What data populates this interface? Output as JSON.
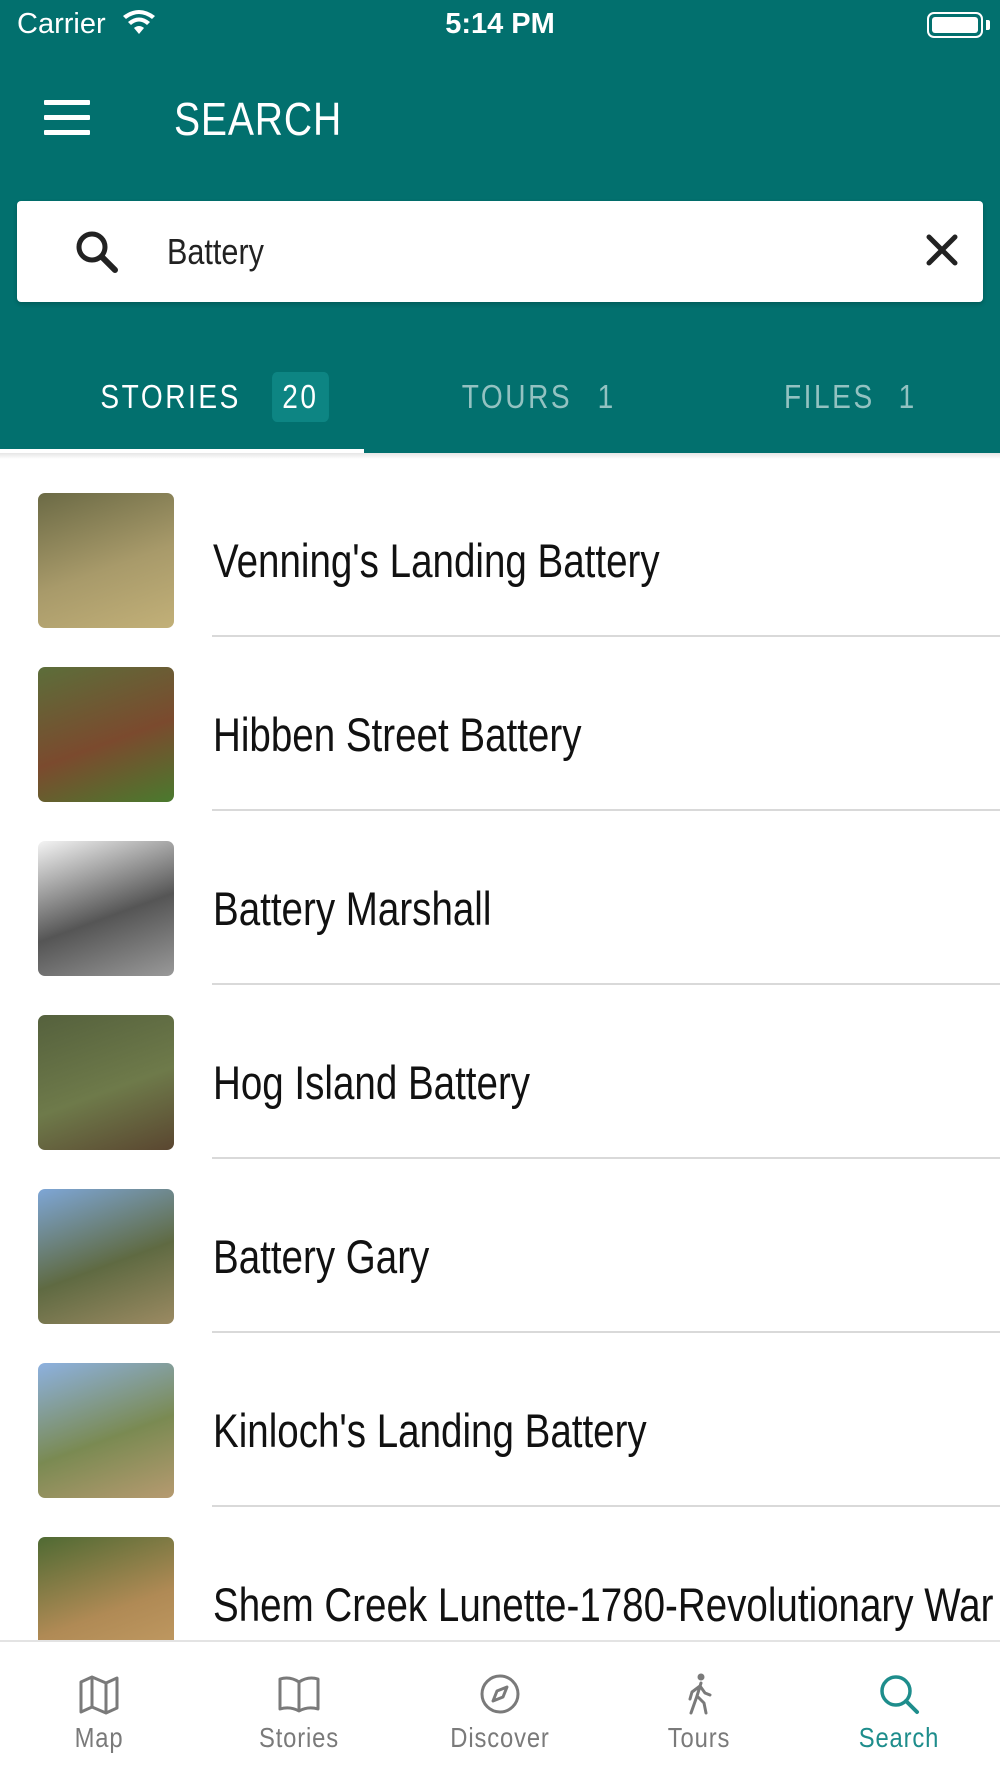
{
  "status_bar": {
    "carrier": "Carrier",
    "time": "5:14 PM"
  },
  "header": {
    "title": "SEARCH"
  },
  "search": {
    "value": "Battery",
    "placeholder": ""
  },
  "tabs": [
    {
      "label": "STORIES",
      "count": "20",
      "active": true
    },
    {
      "label": "TOURS",
      "count": "1",
      "active": false
    },
    {
      "label": "FILES",
      "count": "1",
      "active": false
    }
  ],
  "results": [
    {
      "title": "Venning's Landing Battery",
      "thumb_colors": [
        "#6b6a45",
        "#a89a6a",
        "#c2b078"
      ]
    },
    {
      "title": "Hibben Street Battery",
      "thumb_colors": [
        "#5c6e3a",
        "#7b4a2e",
        "#4a7a2e"
      ]
    },
    {
      "title": "Battery Marshall",
      "thumb_colors": [
        "#f4f4f4",
        "#555555",
        "#999999"
      ]
    },
    {
      "title": "Hog Island Battery",
      "thumb_colors": [
        "#55613d",
        "#6e7a4a",
        "#5a4630"
      ]
    },
    {
      "title": "Battery Gary",
      "thumb_colors": [
        "#7ea6d6",
        "#5f6a42",
        "#9b8a62"
      ]
    },
    {
      "title": "Kinloch's Landing Battery",
      "thumb_colors": [
        "#8db1e0",
        "#7a8a52",
        "#b69a70"
      ]
    },
    {
      "title": "Shem Creek Lunette-1780-Revolutionary War",
      "thumb_colors": [
        "#4f6a33",
        "#b08a55",
        "#c69f66"
      ]
    }
  ],
  "tabbar": [
    {
      "label": "Map",
      "icon": "map-icon",
      "active": false
    },
    {
      "label": "Stories",
      "icon": "book-icon",
      "active": false
    },
    {
      "label": "Discover",
      "icon": "compass-icon",
      "active": false
    },
    {
      "label": "Tours",
      "icon": "walking-icon",
      "active": false
    },
    {
      "label": "Search",
      "icon": "search-icon",
      "active": true
    }
  ],
  "colors": {
    "header": "#02706e",
    "active_tab": "#1e8d8c",
    "inactive_tab_text": "#93c2c1"
  }
}
